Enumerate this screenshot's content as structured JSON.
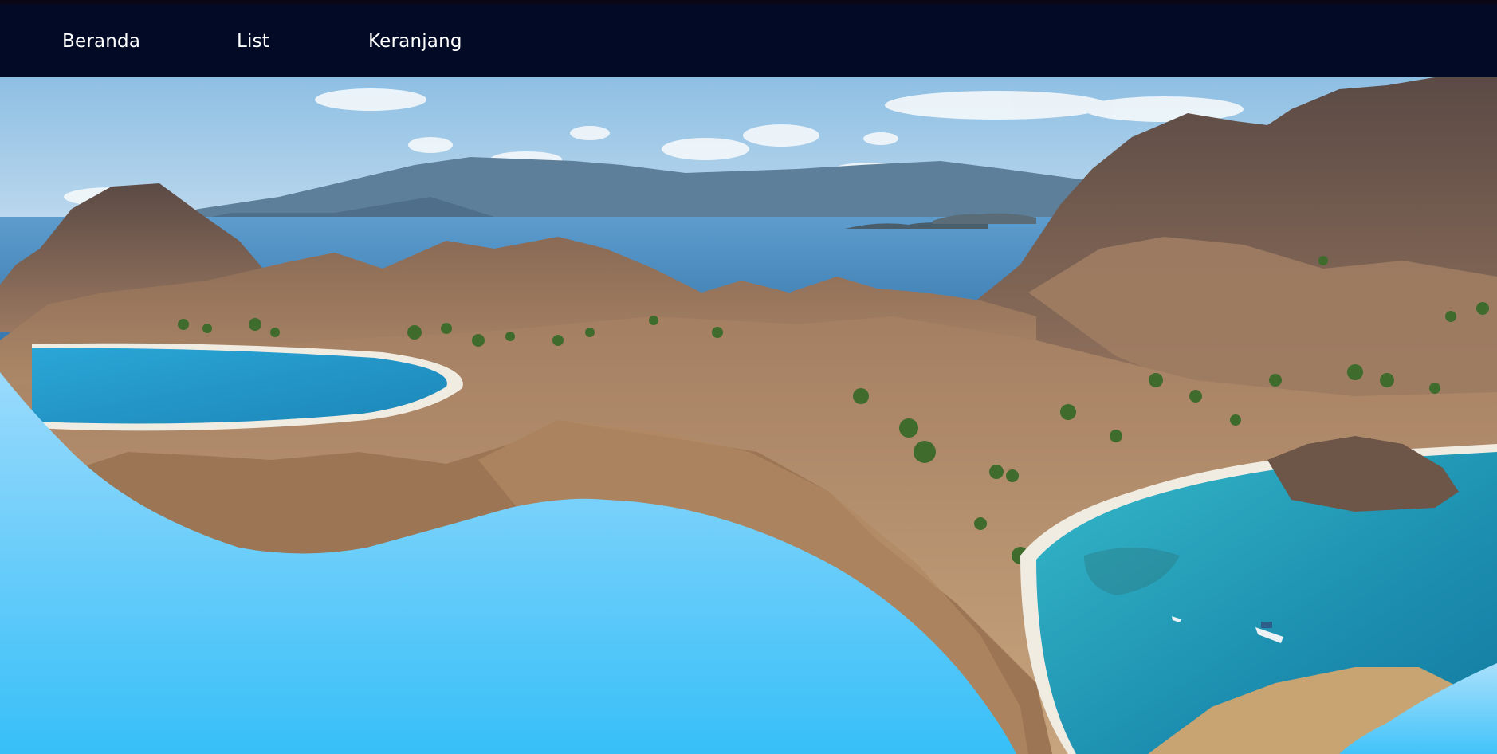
{
  "nav": {
    "items": [
      {
        "label": "Beranda"
      },
      {
        "label": "List"
      },
      {
        "label": "Keranjang"
      }
    ]
  },
  "hero": {
    "image": "island-landscape",
    "wave_color_top": "#9adafc",
    "wave_color_bottom": "#37bff8"
  },
  "colors": {
    "navbar_bg": "#020a26",
    "nav_text": "#ffffff"
  }
}
